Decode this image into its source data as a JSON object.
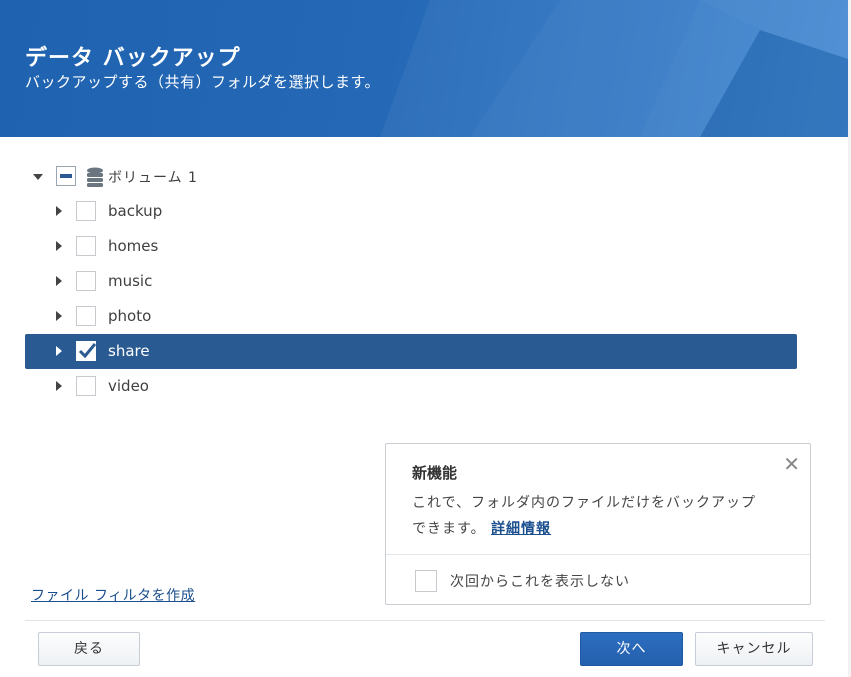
{
  "header": {
    "title": "データ バックアップ",
    "subtitle": "バックアップする（共有）フォルダを選択します。"
  },
  "tree": {
    "volume_label": "ボリューム 1",
    "folders": [
      {
        "label": "backup",
        "checked": false,
        "selected": false
      },
      {
        "label": "homes",
        "checked": false,
        "selected": false
      },
      {
        "label": "music",
        "checked": false,
        "selected": false
      },
      {
        "label": "photo",
        "checked": false,
        "selected": false
      },
      {
        "label": "share",
        "checked": true,
        "selected": true
      },
      {
        "label": "video",
        "checked": false,
        "selected": false
      }
    ]
  },
  "popup": {
    "title": "新機能",
    "close": "✕",
    "body": "これで、フォルダ内のファイルだけをバックアップできます。",
    "link": "詳細情報",
    "checkbox_label": "次回からこれを表示しない"
  },
  "filter_link": "ファイル フィルタを作成",
  "buttons": {
    "back": "戻る",
    "next": "次へ",
    "cancel": "キャンセル"
  },
  "colors": {
    "header": "#2466b4",
    "selection": "#2a5a92",
    "primary_button": "#2a67b8",
    "link": "#1b4f8e"
  }
}
